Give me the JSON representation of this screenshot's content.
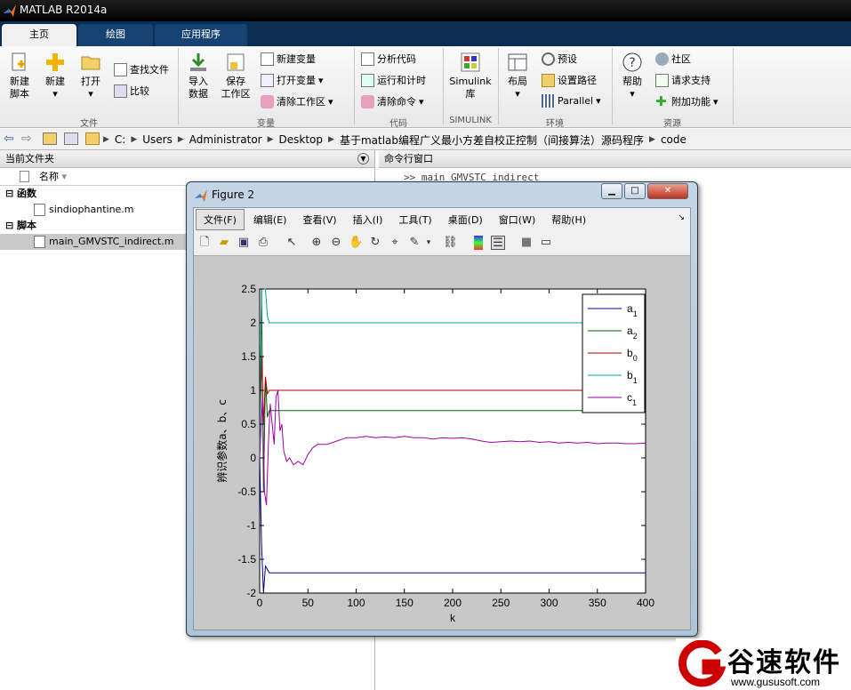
{
  "window": {
    "title": "MATLAB R2014a"
  },
  "tabs": [
    {
      "label": "主页"
    },
    {
      "label": "绘图"
    },
    {
      "label": "应用程序"
    }
  ],
  "ribbon": {
    "new_script": "新建\n脚本",
    "new": "新建",
    "open": "打开",
    "find_files": "查找文件",
    "compare": "比较",
    "group_file": "文件",
    "import_data": "导入\n数据",
    "save_workspace": "保存\n工作区",
    "new_variable": "新建变量",
    "open_variable": "打开变量",
    "clear_workspace": "清除工作区",
    "group_variable": "变量",
    "analyze_code": "分析代码",
    "run_and_time": "运行和计时",
    "clear_commands": "清除命令",
    "group_code": "代码",
    "simulink_library": "Simulink\n库",
    "group_simulink": "SIMULINK",
    "layout": "布局",
    "preferences": "预设",
    "set_path": "设置路径",
    "parallel": "Parallel",
    "group_environment": "环境",
    "help": "帮助",
    "community": "社区",
    "request_support": "请求支持",
    "add_ons": "附加功能",
    "group_resources": "资源"
  },
  "address": {
    "crumbs": [
      "C:",
      "Users",
      "Administrator",
      "Desktop",
      "基于matlab编程广义最小方差自校正控制（间接算法）源码程序",
      "code"
    ]
  },
  "left_panel": {
    "title": "当前文件夹",
    "column_name": "名称",
    "group_functions": "函数",
    "file_function": "sindiophantine.m",
    "group_scripts": "脚本",
    "file_script": "main_GMVSTC_indirect.m"
  },
  "right_panel": {
    "title": "命令行窗口",
    "command_line": ">> main_GMVSTC_indirect"
  },
  "figure": {
    "title": "Figure 2",
    "menu": [
      "文件(F)",
      "编辑(E)",
      "查看(V)",
      "插入(I)",
      "工具(T)",
      "桌面(D)",
      "窗口(W)",
      "帮助(H)"
    ]
  },
  "chart_data": {
    "type": "line",
    "xlabel": "k",
    "ylabel": "辨识参数a、b、c",
    "xlim": [
      0,
      400
    ],
    "ylim": [
      -2,
      2.5
    ],
    "xticks": [
      0,
      50,
      100,
      150,
      200,
      250,
      300,
      350,
      400
    ],
    "yticks": [
      -2,
      -1.5,
      -1,
      -0.5,
      0,
      0.5,
      1,
      1.5,
      2,
      2.5
    ],
    "ytick_labels": [
      "-2",
      "-1.5",
      "-1",
      "-0.5",
      "0",
      "0.5",
      "1",
      "1.5",
      "2",
      "2.5"
    ],
    "legend_position": "top-right",
    "series": [
      {
        "name": "a",
        "sub": "1",
        "color": "#00008b",
        "steady": -1.7,
        "x": [
          0,
          2,
          4,
          6,
          8,
          10,
          400
        ],
        "y": [
          0,
          -1.3,
          -2,
          -1.6,
          -1.65,
          -1.7,
          -1.7
        ]
      },
      {
        "name": "a",
        "sub": "2",
        "color": "#006400",
        "steady": 0.7,
        "x": [
          0,
          2,
          4,
          6,
          8,
          10,
          400
        ],
        "y": [
          0,
          2.5,
          -0.5,
          1.2,
          0.6,
          0.7,
          0.7
        ]
      },
      {
        "name": "b",
        "sub": "0",
        "color": "#b00000",
        "steady": 1.0,
        "x": [
          0,
          2,
          4,
          6,
          8,
          10,
          400
        ],
        "y": [
          0,
          1.5,
          0.5,
          1.2,
          0.95,
          1.0,
          1.0
        ]
      },
      {
        "name": "b",
        "sub": "1",
        "color": "#00a0a0",
        "steady": 2.0,
        "x": [
          0,
          2,
          4,
          6,
          8,
          10,
          400
        ],
        "y": [
          0,
          2.5,
          2.5,
          2.5,
          2.1,
          2.0,
          2.0
        ]
      },
      {
        "name": "c",
        "sub": "1",
        "color": "#a000a0",
        "x": [
          0,
          3,
          5,
          7,
          9,
          11,
          13,
          15,
          17,
          19,
          21,
          23,
          25,
          28,
          31,
          35,
          40,
          45,
          50,
          55,
          60,
          70,
          80,
          90,
          100,
          110,
          120,
          130,
          140,
          150,
          160,
          170,
          180,
          190,
          200,
          210,
          220,
          230,
          240,
          250,
          260,
          270,
          280,
          290,
          300,
          310,
          320,
          330,
          340,
          350,
          360,
          370,
          380,
          390,
          400
        ],
        "y": [
          0,
          0.9,
          -0.5,
          -0.7,
          0.2,
          0.8,
          0.5,
          0.2,
          0.9,
          1.0,
          0.4,
          0.5,
          0.1,
          -0.05,
          0.0,
          -0.1,
          -0.05,
          -0.1,
          0.05,
          0.15,
          0.2,
          0.2,
          0.25,
          0.3,
          0.3,
          0.32,
          0.3,
          0.31,
          0.3,
          0.32,
          0.3,
          0.3,
          0.28,
          0.3,
          0.29,
          0.3,
          0.28,
          0.25,
          0.23,
          0.24,
          0.25,
          0.24,
          0.25,
          0.23,
          0.24,
          0.22,
          0.23,
          0.22,
          0.23,
          0.21,
          0.22,
          0.22,
          0.21,
          0.21,
          0.22
        ]
      }
    ]
  },
  "watermark": {
    "brand": "谷速软件",
    "url": "www.gususoft.com",
    "color": "#cc0000"
  }
}
